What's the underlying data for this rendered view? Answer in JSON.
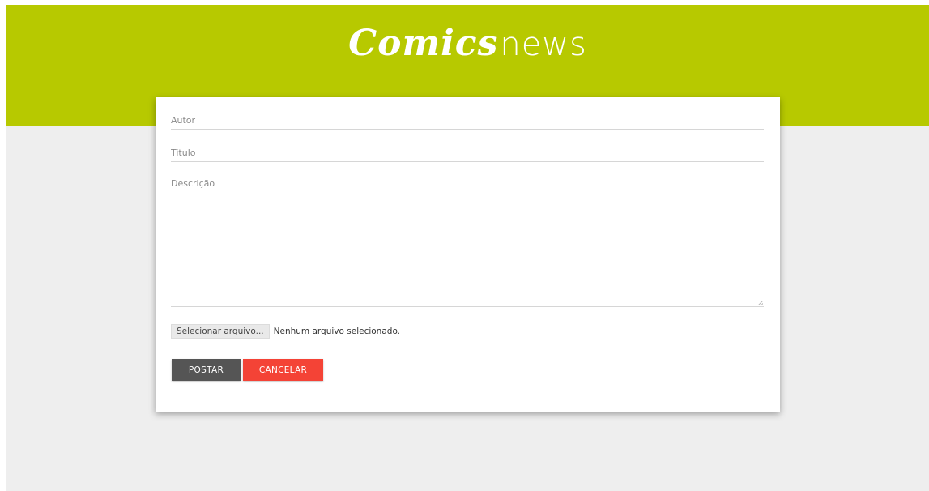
{
  "header": {
    "logo_bold": "Comics",
    "logo_light": "news",
    "background_color": "#b7c900"
  },
  "form": {
    "autor_placeholder": "Autor",
    "autor_value": "",
    "titulo_placeholder": "Titulo",
    "titulo_value": "",
    "descricao_placeholder": "Descrição",
    "descricao_value": "",
    "file_button_label": "Selecionar arquivo...",
    "file_status": "Nenhum arquivo selecionado.",
    "submit_label": "POSTAR",
    "cancel_label": "CANCELAR"
  },
  "colors": {
    "page_background": "#eeeeee",
    "submit_button": "#555555",
    "cancel_button": "#f44336"
  },
  "icons": {
    "textarea_resize": "resize-grip-icon"
  }
}
